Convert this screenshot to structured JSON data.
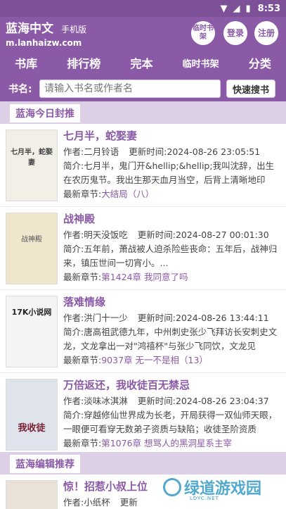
{
  "status_bar": {
    "time": "8:53"
  },
  "header": {
    "site_name": "蓝海中文",
    "site_sub": "手机版",
    "domain": "m.lanhaizw.com",
    "btn_shelf": "临时书架",
    "btn_login": "登录",
    "btn_register": "注册"
  },
  "nav": {
    "items": [
      "书库",
      "排行榜",
      "完本",
      "临时书架",
      "分类"
    ]
  },
  "search": {
    "label": "书名:",
    "placeholder": "请输入书名或作者名",
    "button": "快速搜书"
  },
  "sections": {
    "today": "蓝海今日封推",
    "editor": "蓝海编辑推荐"
  },
  "field_labels": {
    "author": "作者:",
    "updated": "更新时间:",
    "intro": "简介:",
    "latest": "最新章节:"
  },
  "books": [
    {
      "title": "七月半，蛇娶妻",
      "author": "二月铃语",
      "updated": "2024-08-26 23:05:51",
      "intro": "七月半，鬼门开&hellip;&hellip;我叫沈辞，出生在农历鬼节。我出生那天血月当空，后背上清晰地印着...",
      "latest": "大结局（八）",
      "cover_text": "七月半，蛇娶妻"
    },
    {
      "title": "战神殿",
      "author": "明天没饭吃",
      "updated": "2024-08-27 00:01:30",
      "intro": "五年前，萧战被人迫杀险些丧命：五年后，战神归来，镇压世间一切宵小。...",
      "latest": "第1424章 我同意了吗",
      "cover_text": "战神殿"
    },
    {
      "title": "落难情缘",
      "author": "洪门十一少",
      "updated": "2024-08-26 13:44:11",
      "intro": "唐高祖武德九年，中州刺史张少飞拜访长安刺史文龙，文龙拿出一对\"鸿禧杯\"与张少飞同饮，文龙见",
      "latest": "9037章 无一不是相（13）",
      "cover_text": "17K小说网"
    },
    {
      "title": "万倍返还，我收徒百无禁忌",
      "author": "淡味冰淇淋",
      "updated": "2024-08-26 23:04:37",
      "intro": "穿越修仙世界成为长老，开局获得一双仙师天眼，一眼便可看穿无数弟子资质与缺陷；收徒圣阶资质",
      "latest": "第1076章 想骂人的黑洞星系主宰",
      "cover_text": "我收徒"
    },
    {
      "title": "惊！招惹小叔上位",
      "author": "小纸杯",
      "updated": "",
      "intro": "",
      "latest": "",
      "cover_text": ""
    }
  ],
  "watermark": {
    "text": "绿道游戏园",
    "sub": "LDYC.NET"
  }
}
